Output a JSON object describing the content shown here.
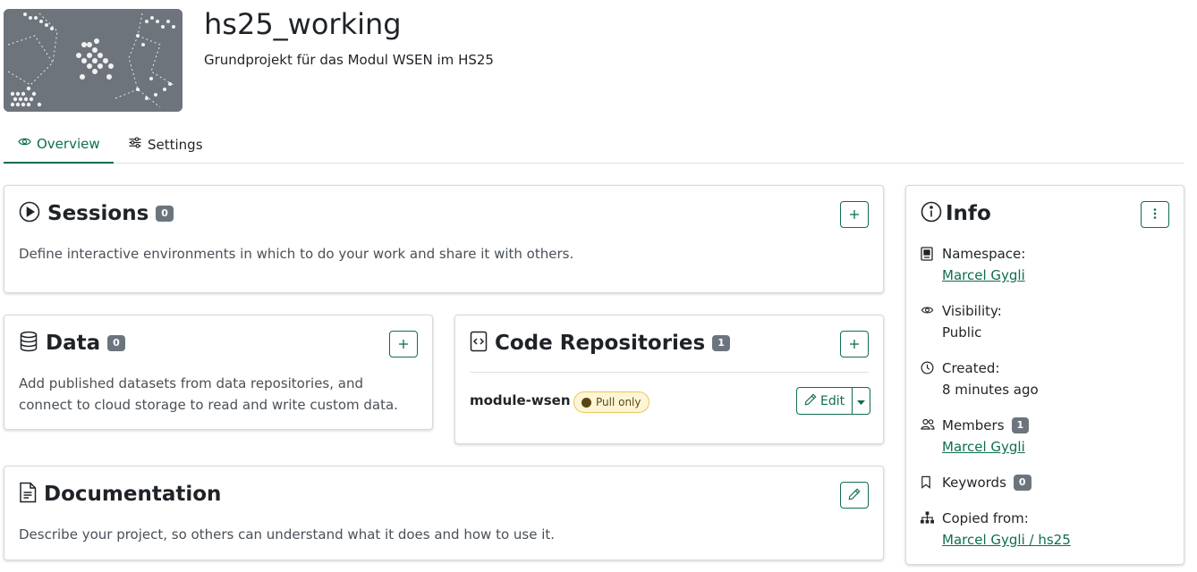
{
  "project": {
    "title": "hs25_working",
    "description": "Grundprojekt für das Modul WSEN im HS25"
  },
  "tabs": [
    {
      "label": "Overview",
      "icon": "eye-icon",
      "active": true
    },
    {
      "label": "Settings",
      "icon": "sliders-icon",
      "active": false
    }
  ],
  "sessions": {
    "title": "Sessions",
    "count": "0",
    "text": "Define interactive environments in which to do your work and share it with others."
  },
  "data": {
    "title": "Data",
    "count": "0",
    "text_line1": "Add published datasets from data repositories, and",
    "text_line2": "connect to cloud storage to read and write custom data."
  },
  "code": {
    "title": "Code Repositories",
    "count": "1",
    "repo_name": "module-wsen",
    "badge": "Pull only",
    "edit_label": "Edit"
  },
  "docs": {
    "title": "Documentation",
    "text": "Describe your project, so others can understand what it does and how to use it."
  },
  "info": {
    "title": "Info",
    "namespace_label": "Namespace:",
    "namespace_value": "Marcel Gygli",
    "visibility_label": "Visibility:",
    "visibility_value": "Public",
    "created_label": "Created:",
    "created_value": "8 minutes ago",
    "members_label": "Members",
    "members_count": "1",
    "members_value": "Marcel Gygli",
    "keywords_label": "Keywords",
    "keywords_count": "0",
    "copied_label": "Copied from:",
    "copied_value": "Marcel Gygli / hs25"
  },
  "colors": {
    "accent": "#0e6e4d",
    "badge_gray": "#6c757d",
    "pull_badge_bg": "#fdf5d6"
  }
}
